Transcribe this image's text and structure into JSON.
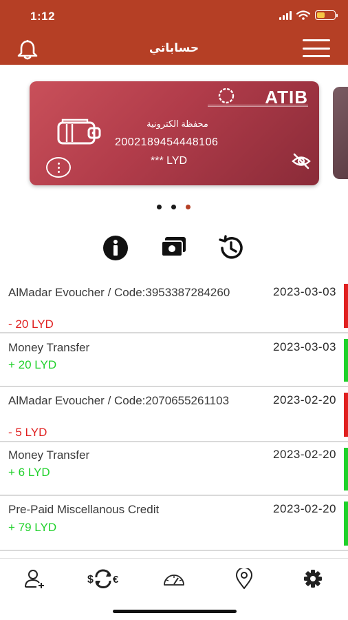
{
  "status_bar": {
    "time": "1:12"
  },
  "header": {
    "title": "حساباتي"
  },
  "card": {
    "type_label": "محفظة الكترونية",
    "account_number": "2002189454448106",
    "balance": "*** LYD",
    "bank_logo_text": "ATIB"
  },
  "carousel": {
    "count": 3,
    "active_index": 2
  },
  "colors": {
    "brand": "#b53f25",
    "debit": "#e02020",
    "credit": "#1fd12a"
  },
  "transactions": [
    {
      "description": "AlMadar Evoucher / Code:3953387284260",
      "date": "2023-03-03",
      "amount": "- 20 LYD",
      "kind": "debit"
    },
    {
      "description": "Money Transfer",
      "date": "2023-03-03",
      "amount": "+ 20 LYD",
      "kind": "credit"
    },
    {
      "description": "AlMadar Evoucher / Code:2070655261103",
      "date": "2023-02-20",
      "amount": "- 5 LYD",
      "kind": "debit"
    },
    {
      "description": "Money Transfer",
      "date": "2023-02-20",
      "amount": "+ 6 LYD",
      "kind": "credit"
    },
    {
      "description": "Pre-Paid Miscellanous Credit",
      "date": "2023-02-20",
      "amount": "+ 79 LYD",
      "kind": "credit"
    }
  ],
  "icons": {
    "header": [
      "bell-icon",
      "menu-icon"
    ],
    "card": [
      "wallet-icon",
      "more-vertical-icon",
      "eye-off-icon"
    ],
    "actions": [
      "info-icon",
      "money-icon",
      "history-icon"
    ],
    "bottom_nav": [
      "add-user-icon",
      "currency-exchange-icon",
      "speedometer-icon",
      "location-pin-icon",
      "settings-gear-icon"
    ]
  }
}
